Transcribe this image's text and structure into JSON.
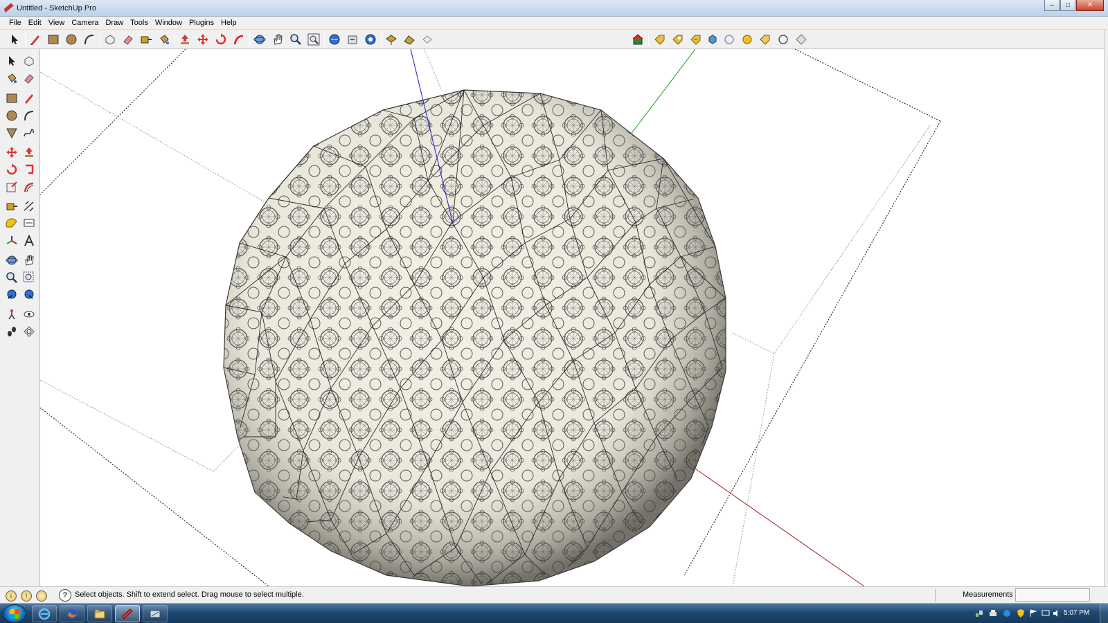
{
  "window": {
    "title": "Untitled - SketchUp Pro",
    "buttons": {
      "minimize": "–",
      "maximize": "□",
      "close": "✕"
    }
  },
  "menubar": {
    "items": [
      "File",
      "Edit",
      "View",
      "Camera",
      "Draw",
      "Tools",
      "Window",
      "Plugins",
      "Help"
    ]
  },
  "top_toolbar": {
    "tools": [
      "select",
      "pencil",
      "rectangle",
      "circle",
      "arc",
      "make-component",
      "eraser",
      "tape-measure",
      "paint-bucket",
      "push-pull",
      "move",
      "rotate",
      "follow-me",
      "orbit",
      "pan",
      "zoom",
      "zoom-extents",
      "get-models",
      "share-model",
      "share-component",
      "add-location",
      "toggle-terrain",
      "house",
      "plugin-tool"
    ]
  },
  "left_toolbar": {
    "tools": [
      "select",
      "make-component",
      "paint-bucket",
      "eraser",
      "rectangle",
      "line",
      "circle",
      "arc",
      "polygon",
      "freehand",
      "move",
      "push-pull",
      "rotate",
      "follow-me",
      "scale",
      "offset",
      "tape-measure",
      "dimension",
      "protractor",
      "text",
      "axes",
      "3d-text",
      "orbit",
      "pan",
      "zoom",
      "zoom-window",
      "previous",
      "zoom-extents",
      "position-camera",
      "look-around",
      "walk",
      "section-plane"
    ]
  },
  "statusbar": {
    "hint": "Select objects. Shift to extend select. Drag mouse to select multiple.",
    "help_symbol": "?",
    "measurements_label": "Measurements",
    "measurements_value": ""
  },
  "taskbar": {
    "clock": "5:07 PM",
    "apps": [
      "internet-explorer",
      "firefox",
      "file-explorer",
      "sketchup",
      "other-app"
    ]
  },
  "scene": {
    "object": "textured geodesic sphere",
    "axis_colors": {
      "blue": "#2a2acc",
      "green": "#1a9a1a",
      "red": "#a02020"
    }
  }
}
